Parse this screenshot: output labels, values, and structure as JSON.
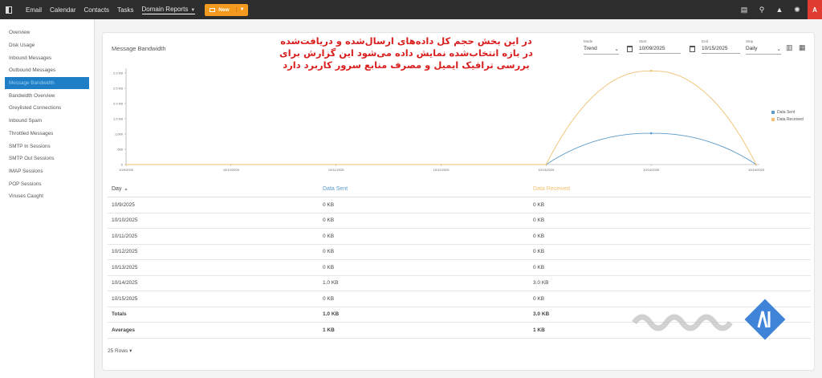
{
  "topbar": {
    "nav": [
      "Email",
      "Calendar",
      "Contacts",
      "Tasks"
    ],
    "active_nav": "Domain Reports",
    "new_label": "New",
    "avatar": "A"
  },
  "sidebar": {
    "items": [
      {
        "label": "Overview"
      },
      {
        "label": "Disk Usage"
      },
      {
        "label": "Inbound Messages"
      },
      {
        "label": "Outbound Messages"
      },
      {
        "label": "Message Bandwidth",
        "active": true
      },
      {
        "label": "Bandwidth Overview"
      },
      {
        "label": "Greylisted Connections"
      },
      {
        "label": "Inbound Spam"
      },
      {
        "label": "Throttled Messages"
      },
      {
        "label": "SMTP In Sessions"
      },
      {
        "label": "SMTP Out Sessions"
      },
      {
        "label": "IMAP Sessions"
      },
      {
        "label": "POP Sessions"
      },
      {
        "label": "Viruses Caught"
      }
    ]
  },
  "report": {
    "title": "Message Bandwidth",
    "note": "در این بخش حجم کل داده‌های ارسال‌شده و دریافت‌شده در بازه انتخاب‌شده نمایش داده می‌شود این گزارش برای بررسی ترافیک ایمیل و مصرف منابع سرور کاربرد دارد",
    "controls": {
      "mode_label": "Mode",
      "mode_value": "Trend",
      "start_label": "Start",
      "start_value": "10/09/2025",
      "end_label": "End",
      "end_value": "10/15/2025",
      "step_label": "Step",
      "step_value": "Daily"
    },
    "table": {
      "headers": [
        "Day",
        "Data Sent",
        "Data Received"
      ],
      "rows": [
        [
          "10/9/2025",
          "0 KB",
          "0 KB"
        ],
        [
          "10/10/2025",
          "0 KB",
          "0 KB"
        ],
        [
          "10/11/2025",
          "0 KB",
          "0 KB"
        ],
        [
          "10/12/2025",
          "0 KB",
          "0 KB"
        ],
        [
          "10/13/2025",
          "0 KB",
          "0 KB"
        ],
        [
          "10/14/2025",
          "1.0 KB",
          "3.0 KB"
        ],
        [
          "10/15/2025",
          "0 KB",
          "0 KB"
        ]
      ],
      "totals": [
        "Totals",
        "1.0 KB",
        "3.0 KB"
      ],
      "averages": [
        "Averages",
        "1 KB",
        "1 KB"
      ]
    },
    "rows_selector": "25 Rows"
  },
  "colors": {
    "sent": "#5b9bc9",
    "received": "#f0c070",
    "accent": "#1e7fc7",
    "brand_orange": "#f39a1e"
  },
  "chart_data": {
    "type": "line",
    "x": [
      "10/9/2025",
      "10/10/2025",
      "10/11/2025",
      "10/12/2025",
      "10/13/2025",
      "10/14/2025",
      "10/15/2025"
    ],
    "series": [
      {
        "name": "Data Sent",
        "values": [
          0,
          0,
          0,
          0,
          0,
          1024,
          0
        ]
      },
      {
        "name": "Data Received",
        "values": [
          0,
          0,
          0,
          0,
          0,
          3072,
          0
        ]
      }
    ],
    "yticks": [
      "0",
      "500",
      "1,000",
      "1.5 KB",
      "2.0 KB",
      "2.5 KB",
      "2.9 KB"
    ],
    "ylim": [
      0,
      3000
    ],
    "legend": "right",
    "grid": false
  }
}
